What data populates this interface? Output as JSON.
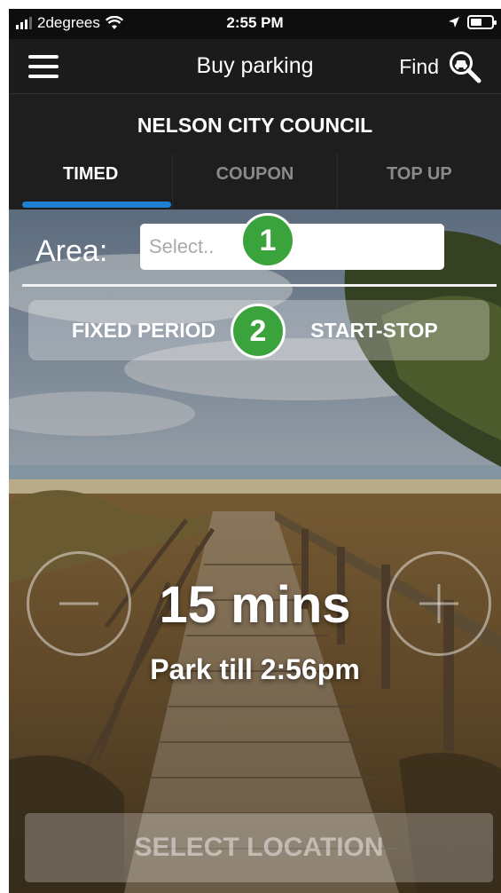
{
  "status_bar": {
    "carrier": "2degrees",
    "time": "2:55 PM"
  },
  "nav": {
    "title": "Buy parking",
    "find_label": "Find"
  },
  "council": "NELSON CITY COUNCIL",
  "tabs": [
    {
      "label": "TIMED",
      "active": true
    },
    {
      "label": "COUPON",
      "active": false
    },
    {
      "label": "TOP UP",
      "active": false
    }
  ],
  "area": {
    "label": "Area:",
    "placeholder": "Select.."
  },
  "mode_toggle": {
    "options": [
      "FIXED PERIOD",
      "START-STOP"
    ]
  },
  "badges": [
    "1",
    "2"
  ],
  "duration": "15 mins",
  "park_till": "Park till 2:56pm",
  "select_location_label": "SELECT LOCATION",
  "colors": {
    "accent": "#1f7fd1",
    "badge": "#3ba33b",
    "header_bg": "#1b1b1b"
  },
  "icons": {
    "menu": "hamburger-icon",
    "find": "magnifier-car-icon",
    "minus": "minus-icon",
    "plus": "plus-icon"
  }
}
